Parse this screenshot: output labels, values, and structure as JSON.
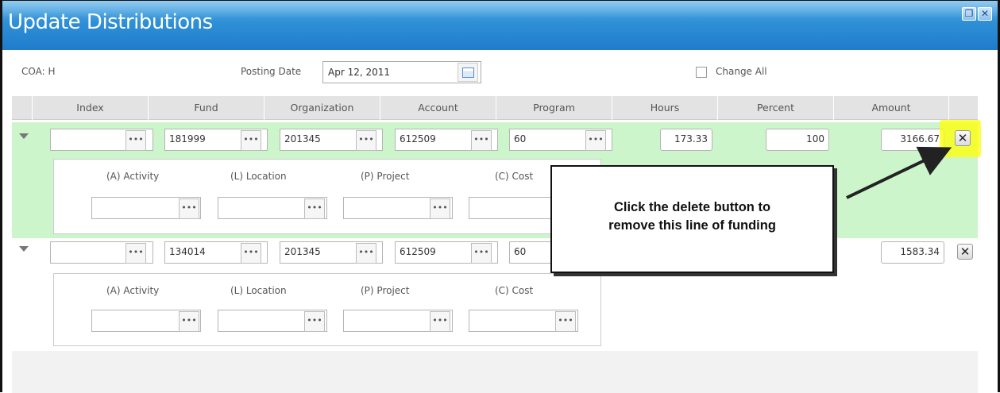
{
  "window": {
    "title": "Update Distributions",
    "restore_icon": "restore-icon",
    "close_icon": "close-icon"
  },
  "header": {
    "coa_label": "COA: H",
    "posting_date_label": "Posting Date",
    "posting_date_value": "Apr 12, 2011",
    "change_all_label": "Change All",
    "change_all_checked": false
  },
  "columns": [
    "Index",
    "Fund",
    "Organization",
    "Account",
    "Program",
    "Hours",
    "Percent",
    "Amount"
  ],
  "rows": [
    {
      "index": "",
      "fund": "181999",
      "organization": "201345",
      "account": "612509",
      "program": "60",
      "hours": "173.33",
      "percent": "100",
      "amount": "3166.67",
      "highlighted": true
    },
    {
      "index": "",
      "fund": "134014",
      "organization": "201345",
      "account": "612509",
      "program": "60",
      "amount": "1583.34",
      "highlighted": false
    }
  ],
  "sub_fields": {
    "activity": "(A) Activity",
    "location": "(L) Location",
    "project": "(P) Project",
    "cost": "(C) Cost"
  },
  "lookup_label": "•••",
  "delete_glyph": "✕",
  "callout": {
    "line1": "Click the delete button to",
    "line2": "remove this line of funding"
  },
  "colors": {
    "title_bar": "#2e8fd6",
    "highlighted_row": "#ccf5cc",
    "highlight_marker": "#ffff00"
  }
}
